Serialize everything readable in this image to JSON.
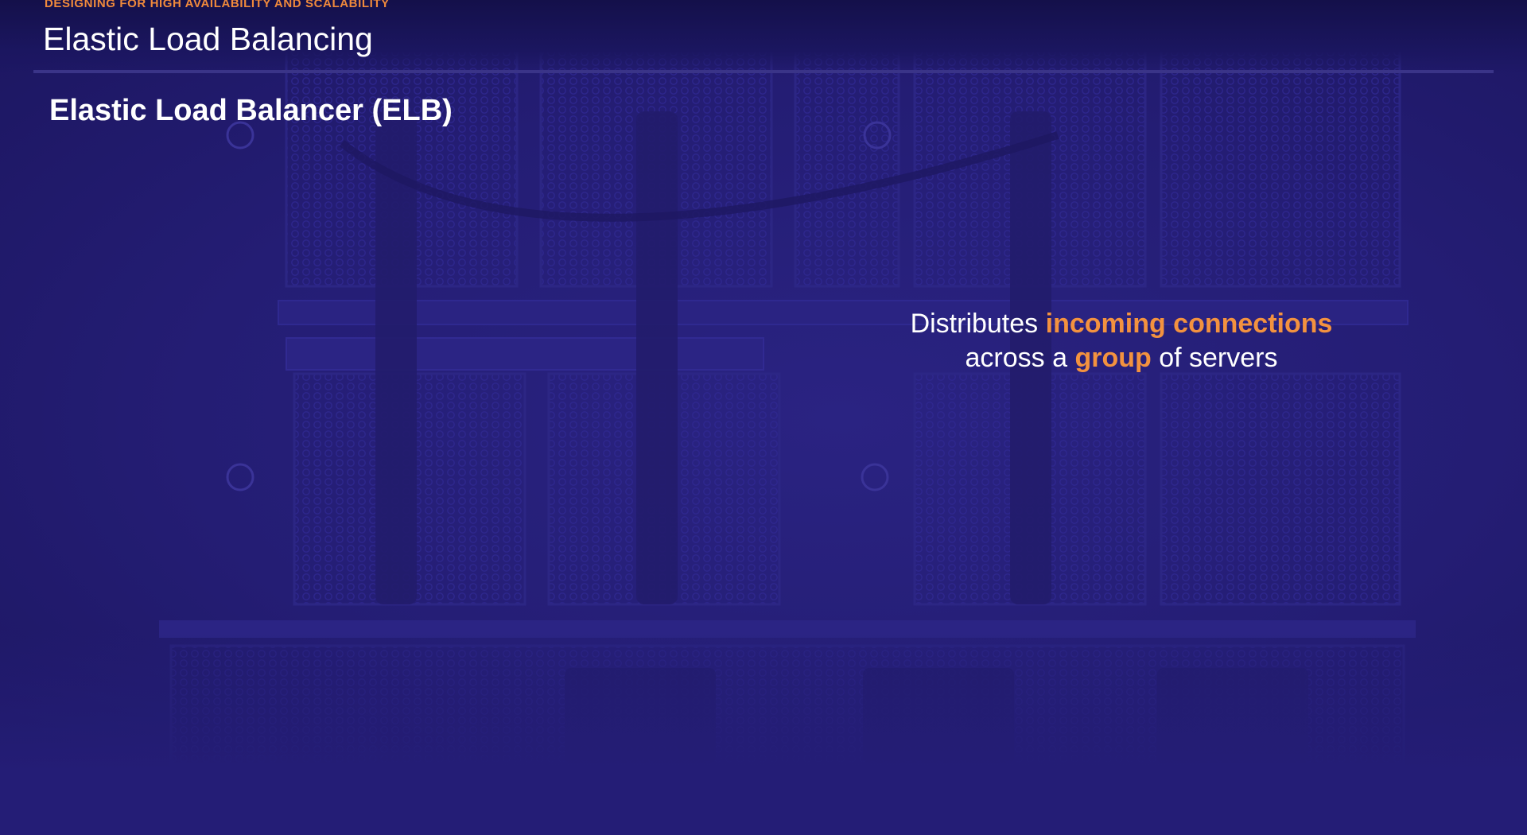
{
  "header": {
    "kicker": "DESIGNING FOR HIGH AVAILABILITY AND SCALABILITY",
    "title": "Elastic Load Balancing"
  },
  "section_title": "Elastic Load Balancer (ELB)",
  "callout": {
    "line1_plain": "Distributes ",
    "line1_highlight": "incoming connections",
    "line2_plain_before": "across a ",
    "line2_highlight": "group",
    "line2_plain_after": " of servers"
  },
  "colors": {
    "background": "#231d72",
    "accent": "#f08a3c",
    "text": "#ffffff",
    "rule": "#3a3488"
  }
}
